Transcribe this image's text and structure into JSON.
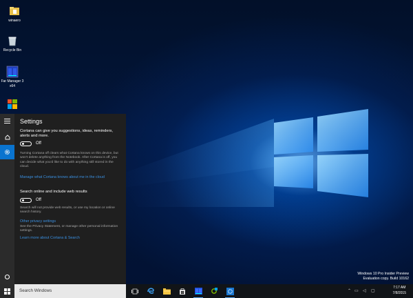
{
  "desktop": {
    "icons": [
      {
        "label": "winaero",
        "icon": "folder-icon"
      },
      {
        "label": "Recycle Bin",
        "icon": "recycle-bin-icon"
      },
      {
        "label": "Far Manager 3 x64",
        "icon": "far-manager-icon"
      },
      {
        "label": "",
        "icon": "windows-flag-icon"
      }
    ],
    "watermark": {
      "line1": "Windows 10 Pro Insider Preview",
      "line2": "Evaluation copy. Build 10162"
    }
  },
  "cortana_panel": {
    "rail": [
      {
        "name": "menu",
        "icon": "hamburger-icon"
      },
      {
        "name": "home",
        "icon": "home-icon"
      },
      {
        "name": "settings",
        "icon": "gear-icon",
        "selected": true
      },
      {
        "name": "feedback",
        "icon": "circle-icon"
      }
    ],
    "title": "Settings",
    "intro": "Cortana can give you suggestions, ideas, reminders, alerts and more.",
    "toggle1_state": "Off",
    "toggle1_desc": "Turning Cortana off clears what Cortana knows on this device, but won't delete anything from the Notebook. After Cortana is off, you can decide what you'd like to do with anything still stored in the cloud.",
    "manage_link": "Manage what Cortana knows about me in the cloud",
    "search_online_label": "Search online and include web results",
    "toggle2_state": "Off",
    "toggle2_desc": "Search will not provide web results, or use my location or online search history.",
    "privacy_link": "Other privacy settings",
    "privacy_desc": "See the Privacy Statement, or manage other personal information settings.",
    "learn_link": "Learn more about Cortana & Search"
  },
  "taskbar": {
    "search_placeholder": "Search Windows",
    "clock_time": "7:17 AM",
    "clock_date": "7/8/2015",
    "accent": "#0a74cf"
  }
}
